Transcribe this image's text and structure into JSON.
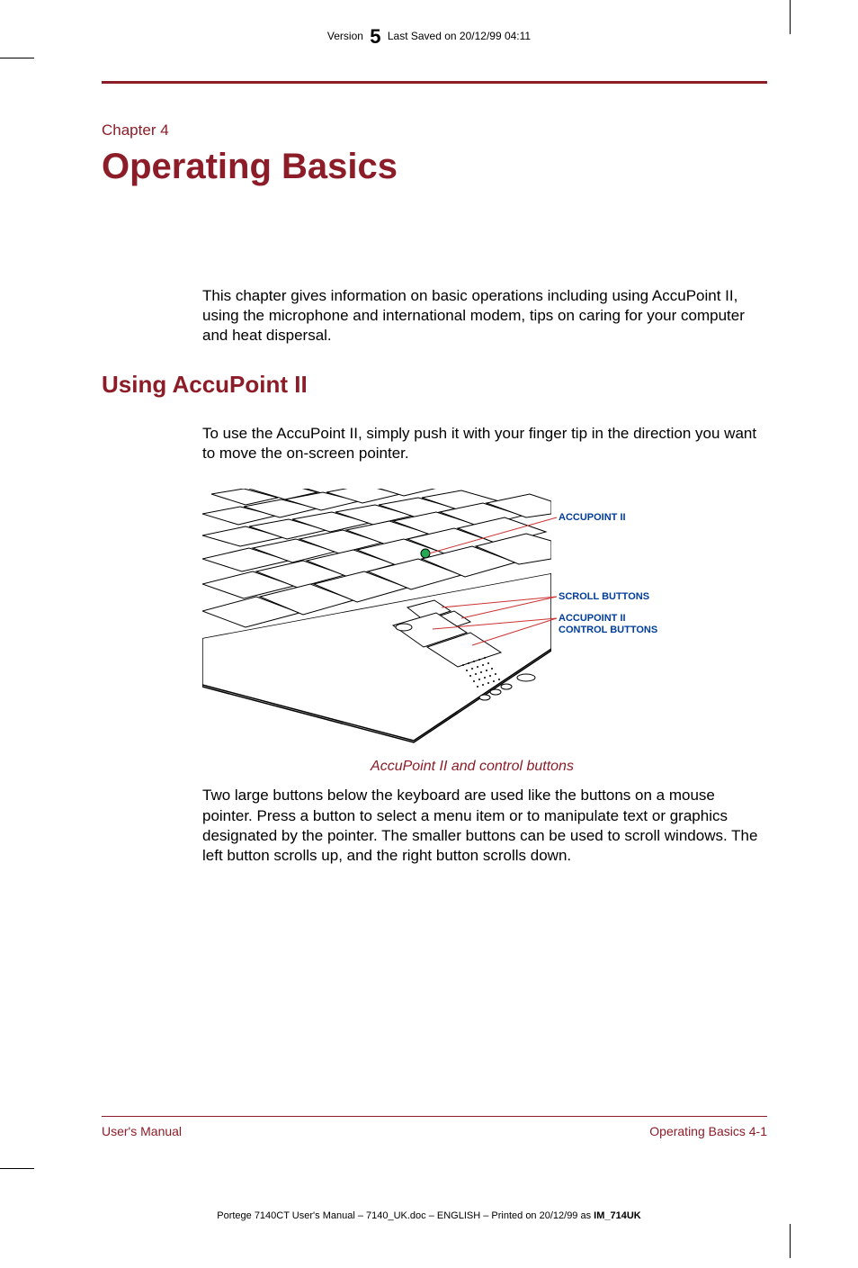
{
  "header": {
    "version_label": "Version",
    "version_number": "5",
    "last_saved": "Last Saved on 20/12/99 04:11"
  },
  "chapter": {
    "label": "Chapter 4",
    "title": "Operating Basics",
    "intro": "This chapter gives information on basic operations including using AccuPoint II, using the microphone and international modem, tips on caring for your computer and heat dispersal."
  },
  "section": {
    "heading": "Using AccuPoint II",
    "p1": "To use the AccuPoint II, simply push it with your finger tip in the direction you want to move the on-screen pointer.",
    "p2": "Two large buttons below the keyboard are used like the buttons on a mouse pointer. Press a button to select a menu item or to manipulate text or graphics designated by the pointer. The smaller buttons can be used to scroll windows. The left button scrolls up, and the right button scrolls down."
  },
  "figure": {
    "callout1": "ACCUPOINT II",
    "callout2": "SCROLL BUTTONS",
    "callout3_line1": "ACCUPOINT II",
    "callout3_line2": "CONTROL BUTTONS",
    "caption": "AccuPoint II and control buttons"
  },
  "footer": {
    "left": "User's Manual",
    "right_label": "Operating Basics",
    "right_page": "  4-1"
  },
  "print_footer": {
    "text_prefix": "Portege 7140CT User's Manual  – 7140_UK.doc – ENGLISH – Printed on 20/12/99 as ",
    "text_bold": "IM_714UK"
  }
}
